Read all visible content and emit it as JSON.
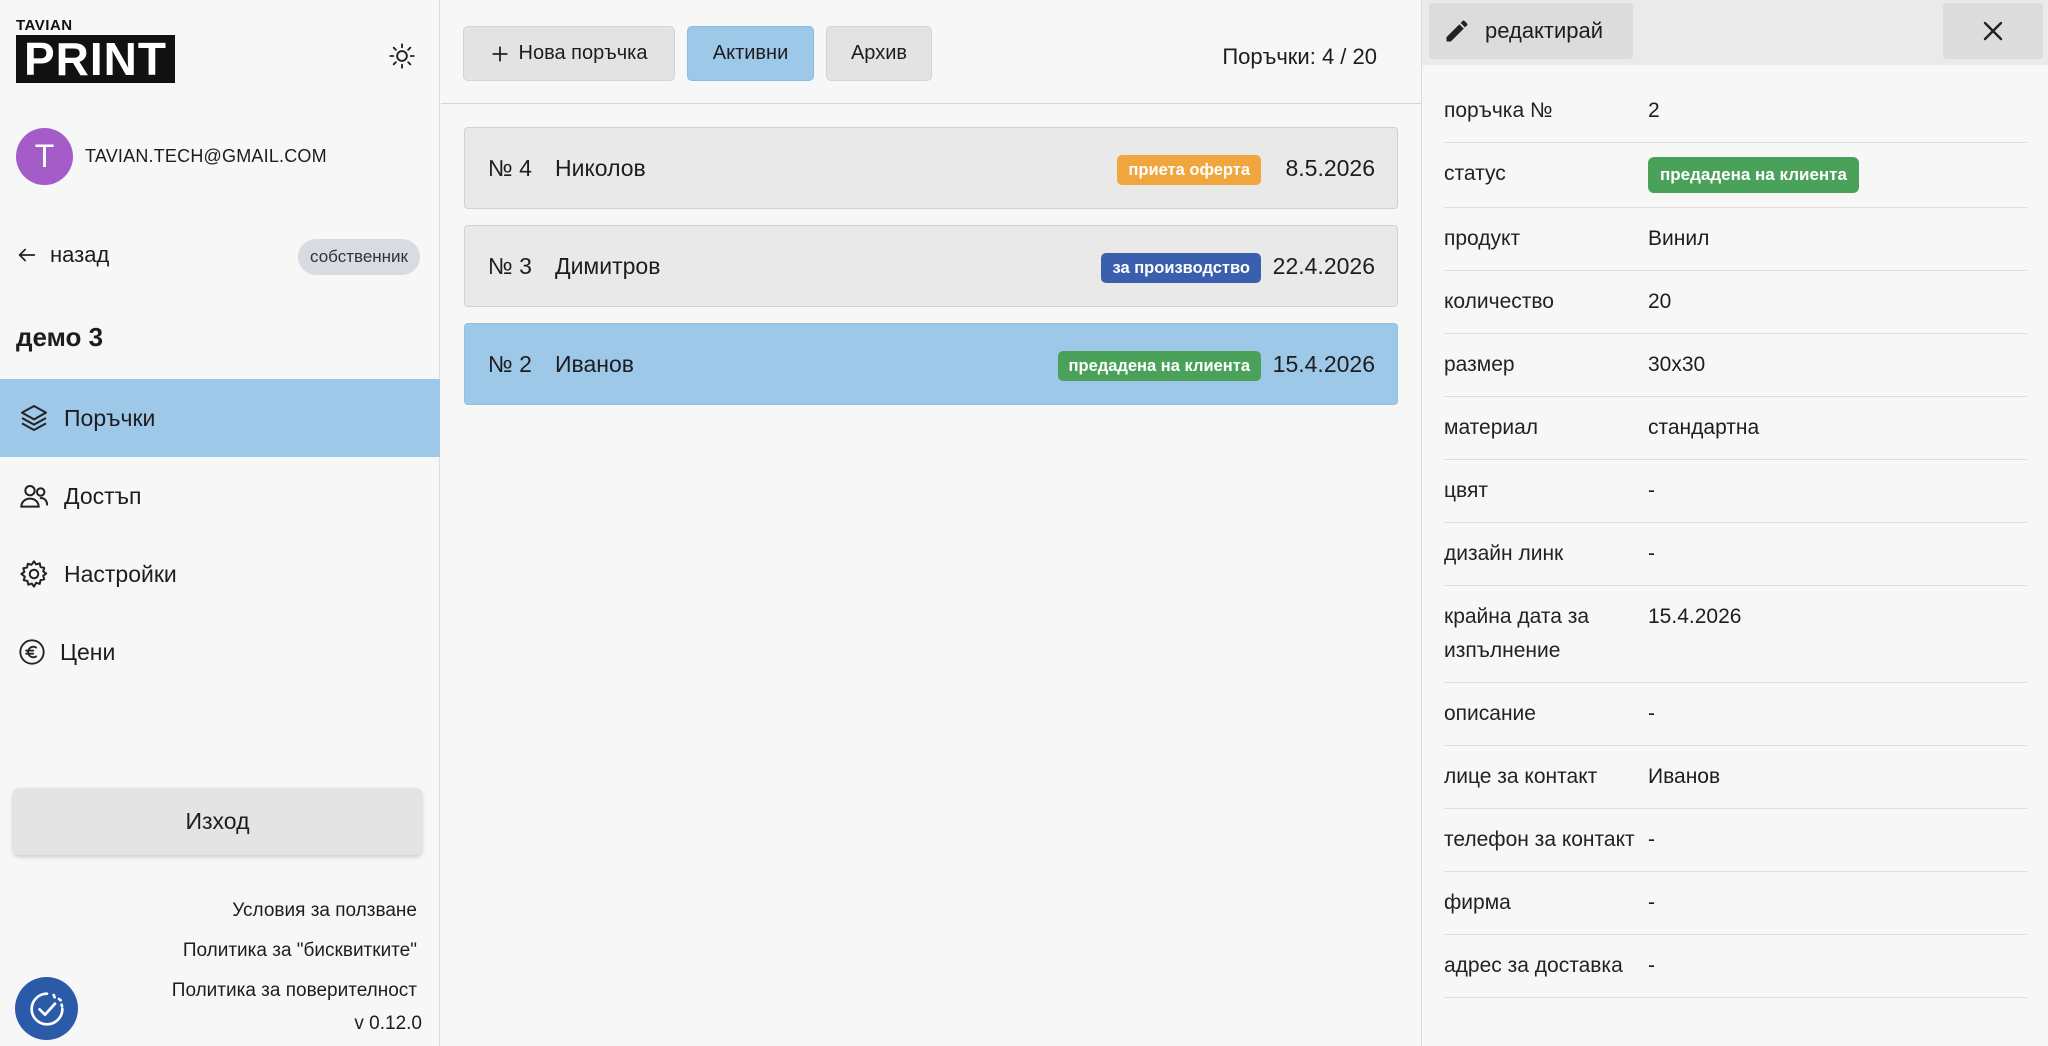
{
  "sidebar": {
    "logo_top": "TAVIAN",
    "logo_main": "PRINT",
    "user": {
      "initial": "T",
      "email": "TAVIAN.TECH@GMAIL.COM"
    },
    "back_label": "назад",
    "role": "собственник",
    "project": "демо 3",
    "nav": [
      {
        "label": "Поръчки",
        "icon": "layers-icon",
        "active": true
      },
      {
        "label": "Достъп",
        "icon": "users-icon",
        "active": false
      },
      {
        "label": "Настройки",
        "icon": "gear-icon",
        "active": false
      },
      {
        "label": "Цени",
        "icon": "euro-icon",
        "active": false
      }
    ],
    "logout_label": "Изход",
    "links": [
      "Условия за ползване",
      "Политика за \"бисквитките\"",
      "Политика за поверителност"
    ],
    "version": "v 0.12.0"
  },
  "toolbar": {
    "new_order": "Нова поръчка",
    "active": "Активни",
    "archive": "Архив",
    "count": "Поръчки: 4 / 20"
  },
  "orders": [
    {
      "number": "№ 4",
      "name": "Николов",
      "status": "приета оферта",
      "status_color": "#f0a63c",
      "date": "8.5.2026",
      "selected": false
    },
    {
      "number": "№ 3",
      "name": "Димитров",
      "status": "за производство",
      "status_color": "#3a5fae",
      "date": "22.4.2026",
      "selected": false
    },
    {
      "number": "№ 2",
      "name": "Иванов",
      "status": "предадена на клиента",
      "status_color": "#4aa25a",
      "date": "15.4.2026",
      "selected": true
    }
  ],
  "detail": {
    "edit_label": "редактирай",
    "fields": [
      {
        "label": "поръчка №",
        "value": "2"
      },
      {
        "label": "статус",
        "value": "предадена на клиента",
        "badge": true
      },
      {
        "label": "продукт",
        "value": "Винил"
      },
      {
        "label": "количество",
        "value": "20"
      },
      {
        "label": "размер",
        "value": "30x30"
      },
      {
        "label": "материал",
        "value": "стандартна"
      },
      {
        "label": "цвят",
        "value": "-"
      },
      {
        "label": "дизайн линк",
        "value": "-"
      },
      {
        "label": "крайна дата за изпълнение",
        "value": "15.4.2026"
      },
      {
        "label": "описание",
        "value": "-"
      },
      {
        "label": "лице за контакт",
        "value": "Иванов"
      },
      {
        "label": "телефон за контакт",
        "value": "-"
      },
      {
        "label": "фирма",
        "value": "-"
      },
      {
        "label": "адрес за доставка",
        "value": "-"
      }
    ]
  },
  "colors": {
    "accent": "#9dc8e8",
    "avatar": "#a45dc8",
    "fab": "#2a5aa8"
  }
}
